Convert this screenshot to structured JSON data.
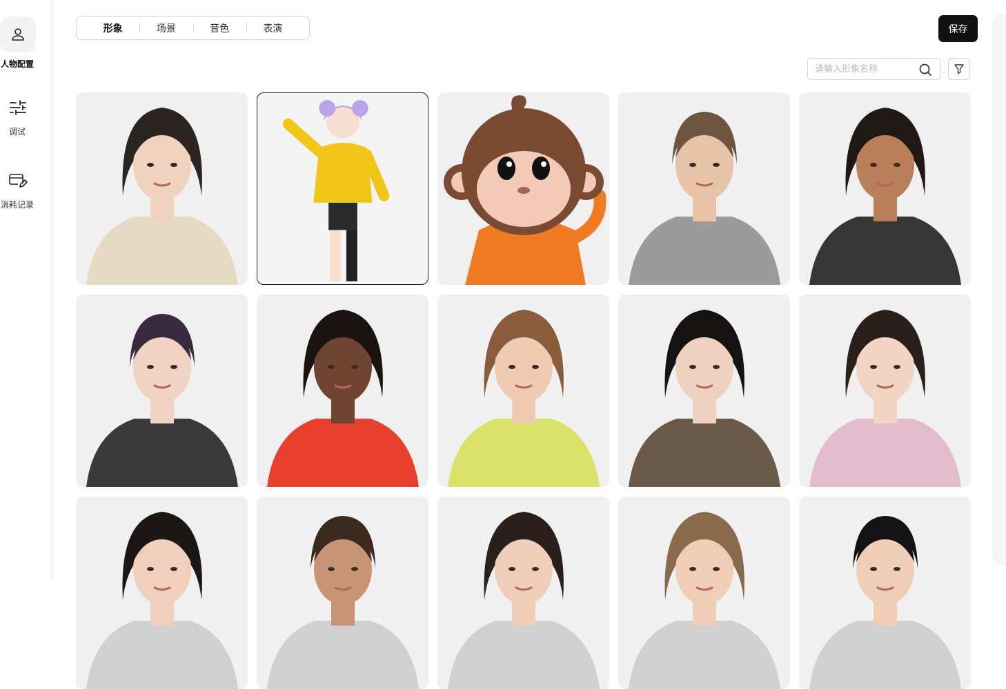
{
  "sidebar": {
    "items": [
      {
        "label": "人物配置",
        "icon": "person-icon",
        "active": true
      },
      {
        "label": "调试",
        "icon": "sliders-icon",
        "active": false
      },
      {
        "label": "消耗记录",
        "icon": "card-edit-icon",
        "active": false
      }
    ]
  },
  "tabs": [
    {
      "label": "形象",
      "active": true
    },
    {
      "label": "场景",
      "active": false
    },
    {
      "label": "音色",
      "active": false
    },
    {
      "label": "表演",
      "active": false
    }
  ],
  "toolbar": {
    "save_label": "保存"
  },
  "search": {
    "placeholder": "请输入形象名称",
    "value": "",
    "icon": "search-icon"
  },
  "filter": {
    "icon": "filter-icon"
  },
  "avatars": [
    {
      "id": "a1",
      "hair": "#2b2421",
      "skin": "#f1d2bf",
      "outfit": "#e6dac3",
      "style": "woman"
    },
    {
      "id": "a2",
      "hair": "#b9a4e8",
      "skin": "#f7ded0",
      "outfit": "#f2c51b",
      "style": "anime",
      "selected": true
    },
    {
      "id": "a3",
      "hair": "#7a4a32",
      "skin": "#f3c9b8",
      "outfit": "#f07b22",
      "style": "monkey"
    },
    {
      "id": "a4",
      "hair": "#6e553f",
      "skin": "#e7c3a8",
      "outfit": "#9b9b9b",
      "style": "man"
    },
    {
      "id": "a5",
      "hair": "#1f1814",
      "skin": "#b97e5a",
      "outfit": "#363636",
      "style": "woman"
    },
    {
      "id": "a6",
      "hair": "#3a2a3e",
      "skin": "#f0d3c2",
      "outfit": "#3a3a3a",
      "style": "man"
    },
    {
      "id": "a7",
      "hair": "#1b1310",
      "skin": "#6f4430",
      "outfit": "#e8402c",
      "style": "woman"
    },
    {
      "id": "a8",
      "hair": "#8a5c3c",
      "skin": "#efcbb3",
      "outfit": "#d9e36a",
      "style": "woman"
    },
    {
      "id": "a9",
      "hair": "#161212",
      "skin": "#efd1bf",
      "outfit": "#6b5a48",
      "style": "woman"
    },
    {
      "id": "a10",
      "hair": "#2a1f1a",
      "skin": "#f2d4c3",
      "outfit": "#e2bccb",
      "style": "woman"
    },
    {
      "id": "a11",
      "hair": "#1c1614",
      "skin": "#f0cfbd",
      "outfit": "#d0d0d0",
      "style": "woman"
    },
    {
      "id": "a12",
      "hair": "#3c2a1f",
      "skin": "#c99474",
      "outfit": "#d0d0d0",
      "style": "man"
    },
    {
      "id": "a13",
      "hair": "#2a201b",
      "skin": "#efcdb9",
      "outfit": "#d0d0d0",
      "style": "woman"
    },
    {
      "id": "a14",
      "hair": "#8a6a4c",
      "skin": "#f0cdb6",
      "outfit": "#d0d0d0",
      "style": "woman"
    },
    {
      "id": "a15",
      "hair": "#141212",
      "skin": "#efcdb7",
      "outfit": "#d0d0d0",
      "style": "man"
    }
  ]
}
